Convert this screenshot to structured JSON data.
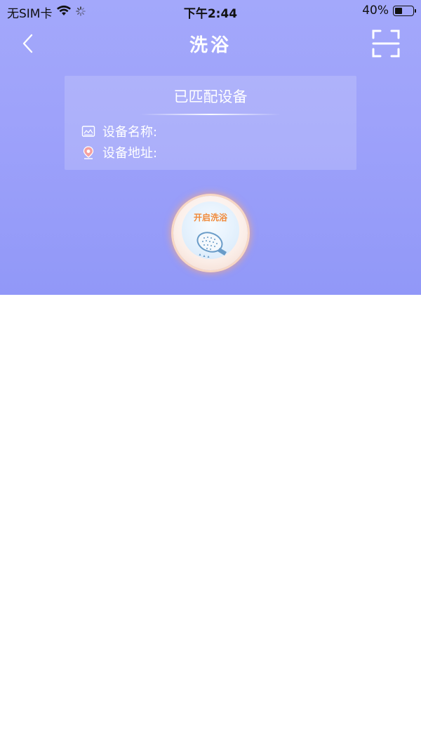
{
  "status_bar": {
    "carrier": "无SIM卡",
    "time": "下午2:44",
    "battery": "40%",
    "battery_level": 0.4
  },
  "nav": {
    "title": "洗浴",
    "back_icon": "chevron-left-icon",
    "scan_icon": "scan-icon"
  },
  "device_card": {
    "title": "已匹配设备",
    "name_label": "设备名称:",
    "address_label": "设备地址:"
  },
  "start_button": {
    "label": "开启洗浴",
    "icon": "shower-head-icon"
  },
  "colors": {
    "header_gradient_top": "#a3a8fb",
    "header_gradient_bottom": "#9198f8",
    "accent_orange": "#f08a3a"
  }
}
